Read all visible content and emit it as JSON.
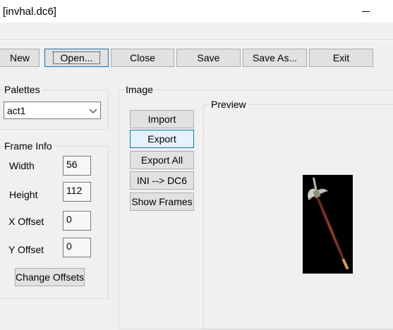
{
  "window": {
    "title": "[invhal.dc6]"
  },
  "toolbar": {
    "new_label": "New",
    "open_label": "Open...",
    "close_label": "Close",
    "save_label": "Save",
    "save_as_label": "Save As...",
    "exit_label": "Exit"
  },
  "palettes": {
    "label": "Palettes",
    "selected": "act1"
  },
  "frame_info": {
    "label": "Frame Info",
    "width_label": "Width",
    "width_value": "56",
    "height_label": "Height",
    "height_value": "112",
    "x_offset_label": "X Offset",
    "x_offset_value": "0",
    "y_offset_label": "Y Offset",
    "y_offset_value": "0",
    "change_offsets_label": "Change Offsets"
  },
  "image": {
    "label": "Image",
    "import_label": "Import",
    "export_label": "Export",
    "export_all_label": "Export All",
    "ini_dc6_label": "INI --> DC6",
    "show_frames_label": "Show Frames"
  },
  "preview": {
    "label": "Preview",
    "image_icon": "halberd-item-icon"
  },
  "colors": {
    "accent": "#0078d7",
    "window_bg": "#f0f0f0",
    "button_bg": "#e1e1e1"
  }
}
